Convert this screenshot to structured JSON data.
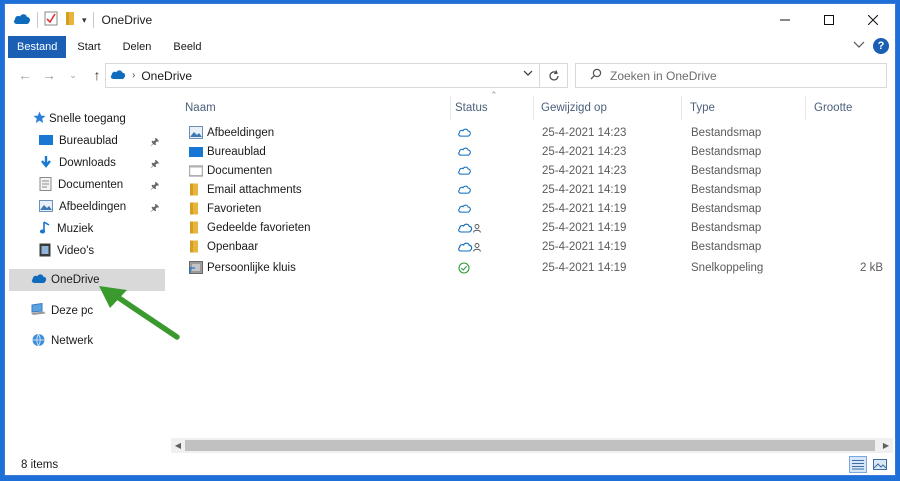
{
  "window": {
    "title": "OneDrive"
  },
  "ribbon": {
    "tabs": [
      "Bestand",
      "Start",
      "Delen",
      "Beeld"
    ]
  },
  "address": {
    "path": "OneDrive",
    "search_placeholder": "Zoeken in OneDrive"
  },
  "nav": {
    "quick_access": "Snelle toegang",
    "quick_items": [
      {
        "label": "Bureaublad",
        "icon": "desktop-icon",
        "pinned": true
      },
      {
        "label": "Downloads",
        "icon": "download-icon",
        "pinned": true
      },
      {
        "label": "Documenten",
        "icon": "documents-icon",
        "pinned": true
      },
      {
        "label": "Afbeeldingen",
        "icon": "pictures-icon",
        "pinned": true
      },
      {
        "label": "Muziek",
        "icon": "music-icon",
        "pinned": false
      },
      {
        "label": "Video's",
        "icon": "video-icon",
        "pinned": false
      }
    ],
    "onedrive": "OneDrive",
    "this_pc": "Deze pc",
    "network": "Netwerk"
  },
  "columns": {
    "name": "Naam",
    "status": "Status",
    "modified": "Gewijzigd op",
    "type": "Type",
    "size": "Grootte"
  },
  "files": [
    {
      "name": "Afbeeldingen",
      "icon": "pictures-folder-icon",
      "status": "cloud",
      "modified": "25-4-2021 14:23",
      "type": "Bestandsmap",
      "size": ""
    },
    {
      "name": "Bureaublad",
      "icon": "desktop-folder-icon",
      "status": "cloud",
      "modified": "25-4-2021 14:23",
      "type": "Bestandsmap",
      "size": ""
    },
    {
      "name": "Documenten",
      "icon": "documents-folder-icon",
      "status": "cloud",
      "modified": "25-4-2021 14:23",
      "type": "Bestandsmap",
      "size": ""
    },
    {
      "name": "Email attachments",
      "icon": "folder-icon",
      "status": "cloud",
      "modified": "25-4-2021 14:19",
      "type": "Bestandsmap",
      "size": ""
    },
    {
      "name": "Favorieten",
      "icon": "folder-icon",
      "status": "cloud",
      "modified": "25-4-2021 14:19",
      "type": "Bestandsmap",
      "size": ""
    },
    {
      "name": "Gedeelde favorieten",
      "icon": "folder-icon",
      "status": "cloud-shared",
      "modified": "25-4-2021 14:19",
      "type": "Bestandsmap",
      "size": ""
    },
    {
      "name": "Openbaar",
      "icon": "folder-icon",
      "status": "cloud-shared",
      "modified": "25-4-2021 14:19",
      "type": "Bestandsmap",
      "size": ""
    },
    {
      "name": "Persoonlijke kluis",
      "icon": "vault-shortcut-icon",
      "status": "synced",
      "modified": "25-4-2021 14:19",
      "type": "Snelkoppeling",
      "size": "2 kB"
    }
  ],
  "status_bar": {
    "count": "8 items"
  },
  "colors": {
    "accent": "#1a5fb4",
    "onedrive": "#0f6cbd",
    "folder": "#e8b53c",
    "arrow": "#3a9a2e",
    "selected": "#d9d9d9"
  }
}
